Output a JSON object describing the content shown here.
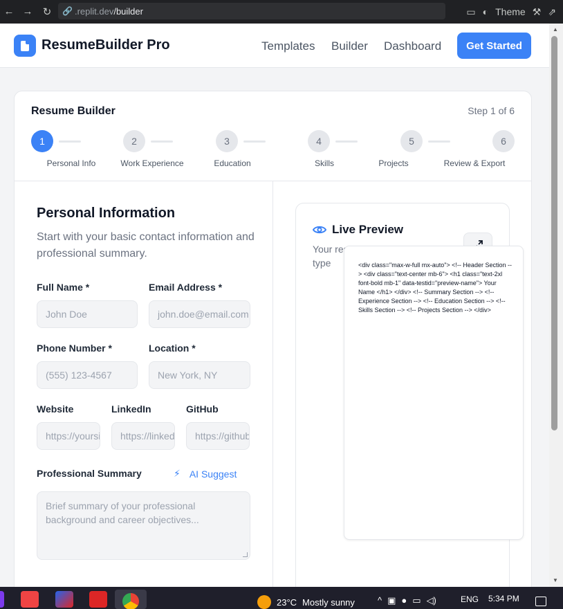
{
  "browser": {
    "url_host": ".replit.dev",
    "url_path": "/builder",
    "theme_label": "Theme"
  },
  "navbar": {
    "brand": "ResumeBuilder Pro",
    "links": [
      "Templates",
      "Builder",
      "Dashboard"
    ],
    "cta": "Get Started"
  },
  "builder": {
    "title": "Resume Builder",
    "step_label": "Step 1 of 6",
    "steps": [
      {
        "num": "1",
        "label": "Personal Info"
      },
      {
        "num": "2",
        "label": "Work Experience"
      },
      {
        "num": "3",
        "label": "Education"
      },
      {
        "num": "4",
        "label": "Skills"
      },
      {
        "num": "5",
        "label": "Projects"
      },
      {
        "num": "6",
        "label": "Review & Export"
      }
    ]
  },
  "form": {
    "title": "Personal Information",
    "subtitle": "Start with your basic contact information and professional summary.",
    "full_name_label": "Full Name *",
    "full_name_placeholder": "John Doe",
    "email_label": "Email Address *",
    "email_placeholder": "john.doe@email.com",
    "phone_label": "Phone Number *",
    "phone_placeholder": "(555) 123-4567",
    "location_label": "Location *",
    "location_placeholder": "New York, NY",
    "website_label": "Website",
    "website_placeholder": "https://yoursite.com",
    "linkedin_label": "LinkedIn",
    "linkedin_placeholder": "https://linkedin.com/in/",
    "github_label": "GitHub",
    "github_placeholder": "https://github.com/",
    "summary_label": "Professional Summary",
    "ai_suggest": "AI Suggest",
    "summary_placeholder": "Brief summary of your professional background and career objectives..."
  },
  "preview": {
    "title": "Live Preview",
    "subtitle": "Your resume updates as you type",
    "code": "<div class=\"max-w-full mx-auto\"> <!-- Header Section --> <div class=\"text-center mb-6\"> <h1 class=\"text-2xl font-bold mb-1\" data-testid=\"preview-name\"> Your Name </h1> </div> <!-- Summary Section --> <!-- Experience Section --> <!-- Education Section --> <!-- Skills Section --> <!-- Projects Section --> </div>"
  },
  "taskbar": {
    "temperature": "23°C",
    "weather": "Mostly sunny",
    "lang": "ENG",
    "time": "5:34 PM"
  },
  "colors": {
    "accent": "#3b82f6",
    "inactive_step": "#e5e7eb"
  }
}
